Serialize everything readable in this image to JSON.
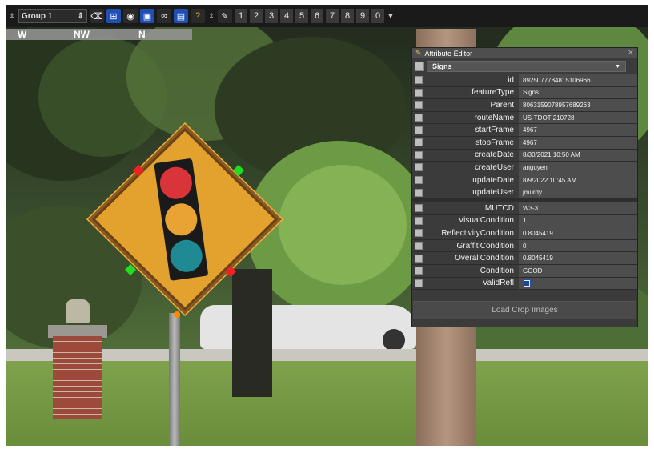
{
  "toolbar": {
    "group_label": "Group 1",
    "icons": [
      "backspace-icon",
      "select-icon",
      "eye-icon",
      "lock-icon",
      "binoculars-icon",
      "save-icon",
      "question-icon",
      "pen-icon"
    ],
    "numbers": [
      "1",
      "2",
      "3",
      "4",
      "5",
      "6",
      "7",
      "8",
      "9",
      "0"
    ]
  },
  "compass": {
    "west": "W",
    "northwest": "NW",
    "north": "N"
  },
  "editor": {
    "title": "Attribute Editor",
    "layer": "Signs",
    "button": "Load Crop Images",
    "attributes": [
      {
        "key": "id",
        "value": "8925077784815106966"
      },
      {
        "key": "featureType",
        "value": "Signs"
      },
      {
        "key": "Parent",
        "value": "8063159078957689263"
      },
      {
        "key": "routeName",
        "value": "US-TDOT-210728"
      },
      {
        "key": "startFrame",
        "value": "4967"
      },
      {
        "key": "stopFrame",
        "value": "4967"
      },
      {
        "key": "createDate",
        "value": "8/30/2021 10:50 AM"
      },
      {
        "key": "createUser",
        "value": "anguyen"
      },
      {
        "key": "updateDate",
        "value": "8/9/2022 10:45 AM"
      },
      {
        "key": "updateUser",
        "value": "jmurdy"
      }
    ],
    "conditions": [
      {
        "key": "MUTCD",
        "value": "W3-3"
      },
      {
        "key": "VisualCondition",
        "value": "1"
      },
      {
        "key": "ReflectivityCondition",
        "value": "0.8045419"
      },
      {
        "key": "GraffitiCondition",
        "value": "0"
      },
      {
        "key": "OverallCondition",
        "value": "0.8045419"
      },
      {
        "key": "Condition",
        "value": "GOOD"
      },
      {
        "key": "ValidRefl",
        "value": ""
      }
    ],
    "valid_refl_checked": true
  },
  "colors": {
    "sign_yellow": "#e3a12e",
    "signal_red": "#d8343a",
    "signal_amber": "#e8a332",
    "signal_teal": "#1f8a94",
    "handle_green": "#22dd22",
    "handle_red": "#ee2222"
  }
}
